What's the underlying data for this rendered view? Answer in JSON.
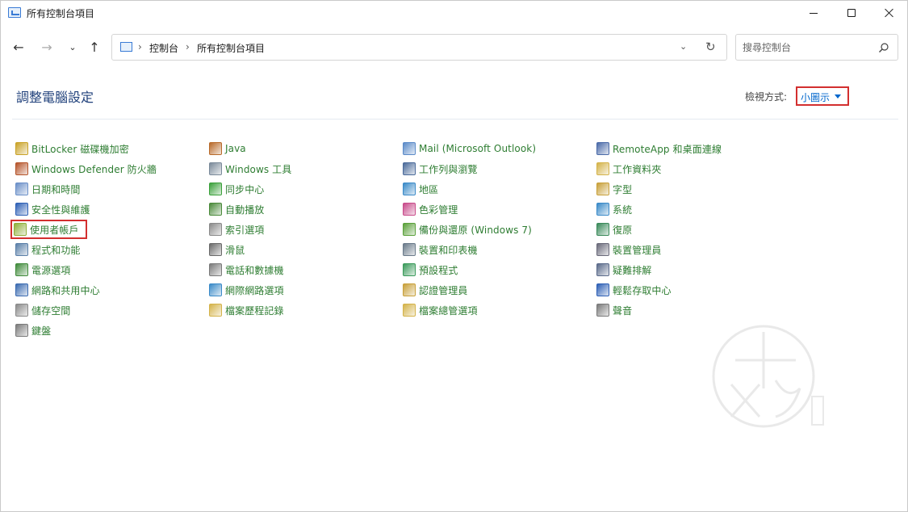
{
  "window": {
    "title": "所有控制台項目"
  },
  "address_bar": {
    "crumbs": [
      "控制台",
      "所有控制台項目"
    ]
  },
  "search": {
    "placeholder": "搜尋控制台"
  },
  "header": {
    "title": "調整電腦設定",
    "view_label": "檢視方式:",
    "view_value": "小圖示"
  },
  "items": {
    "col1": [
      {
        "label": "BitLocker 磁碟機加密",
        "icon": "bitlocker-icon",
        "color": "#c9a227"
      },
      {
        "label": "Windows Defender 防火牆",
        "icon": "firewall-icon",
        "color": "#b5542a"
      },
      {
        "label": "日期和時間",
        "icon": "clock-icon",
        "color": "#6a8fc8"
      },
      {
        "label": "安全性與維護",
        "icon": "flag-icon",
        "color": "#2d5fb5"
      },
      {
        "label": "使用者帳戶",
        "icon": "users-icon",
        "color": "#8fae3a"
      },
      {
        "label": "程式和功能",
        "icon": "programs-icon",
        "color": "#5a7fa8"
      },
      {
        "label": "電源選項",
        "icon": "power-icon",
        "color": "#3f8a3a"
      },
      {
        "label": "網路和共用中心",
        "icon": "network-icon",
        "color": "#3a6ab0"
      },
      {
        "label": "儲存空間",
        "icon": "storage-icon",
        "color": "#8a8a8a"
      },
      {
        "label": "鍵盤",
        "icon": "keyboard-icon",
        "color": "#7a7a7a"
      }
    ],
    "col2": [
      {
        "label": "Java",
        "icon": "java-icon",
        "color": "#b86a2a"
      },
      {
        "label": "Windows 工具",
        "icon": "tools-icon",
        "color": "#7a8a9a"
      },
      {
        "label": "同步中心",
        "icon": "sync-icon",
        "color": "#3aa03a"
      },
      {
        "label": "自動播放",
        "icon": "autoplay-icon",
        "color": "#4a8a3a"
      },
      {
        "label": "索引選項",
        "icon": "index-icon",
        "color": "#8a8a8a"
      },
      {
        "label": "滑鼠",
        "icon": "mouse-icon",
        "color": "#6a6a6a"
      },
      {
        "label": "電話和數據機",
        "icon": "phone-icon",
        "color": "#7a7a7a"
      },
      {
        "label": "網際網路選項",
        "icon": "internet-icon",
        "color": "#3a8ac8"
      },
      {
        "label": "檔案歷程記錄",
        "icon": "file-history-icon",
        "color": "#d4b34a"
      }
    ],
    "col3": [
      {
        "label": "Mail (Microsoft Outlook)",
        "icon": "mail-icon",
        "color": "#5a8ac8"
      },
      {
        "label": "工作列與瀏覽",
        "icon": "taskbar-icon",
        "color": "#4a6a9a"
      },
      {
        "label": "地區",
        "icon": "region-icon",
        "color": "#3a8ac8"
      },
      {
        "label": "色彩管理",
        "icon": "color-icon",
        "color": "#c84a8a"
      },
      {
        "label": "備份與還原 (Windows 7)",
        "icon": "backup-icon",
        "color": "#5aa03a"
      },
      {
        "label": "裝置和印表機",
        "icon": "printer-icon",
        "color": "#6a7a8a"
      },
      {
        "label": "預設程式",
        "icon": "default-programs-icon",
        "color": "#3a9a5a"
      },
      {
        "label": "認證管理員",
        "icon": "credential-icon",
        "color": "#c8a03a"
      },
      {
        "label": "檔案總管選項",
        "icon": "folder-options-icon",
        "color": "#d4b34a"
      }
    ],
    "col4": [
      {
        "label": "RemoteApp 和桌面連線",
        "icon": "remoteapp-icon",
        "color": "#4a6aa8"
      },
      {
        "label": "工作資料夾",
        "icon": "work-folders-icon",
        "color": "#d4b34a"
      },
      {
        "label": "字型",
        "icon": "font-icon",
        "color": "#c8a03a"
      },
      {
        "label": "系統",
        "icon": "system-icon",
        "color": "#3a8ac8"
      },
      {
        "label": "復原",
        "icon": "recovery-icon",
        "color": "#3a8a5a"
      },
      {
        "label": "裝置管理員",
        "icon": "device-manager-icon",
        "color": "#6a6a7a"
      },
      {
        "label": "疑難排解",
        "icon": "troubleshoot-icon",
        "color": "#5a6a8a"
      },
      {
        "label": "輕鬆存取中心",
        "icon": "ease-of-access-icon",
        "color": "#2d5fb5"
      },
      {
        "label": "聲音",
        "icon": "sound-icon",
        "color": "#7a7a7a"
      }
    ]
  },
  "colors": {
    "accent_green": "#2e7d32",
    "title_blue": "#1e3f7a",
    "highlight_red": "#d32f2f",
    "link_blue": "#0066cc"
  }
}
